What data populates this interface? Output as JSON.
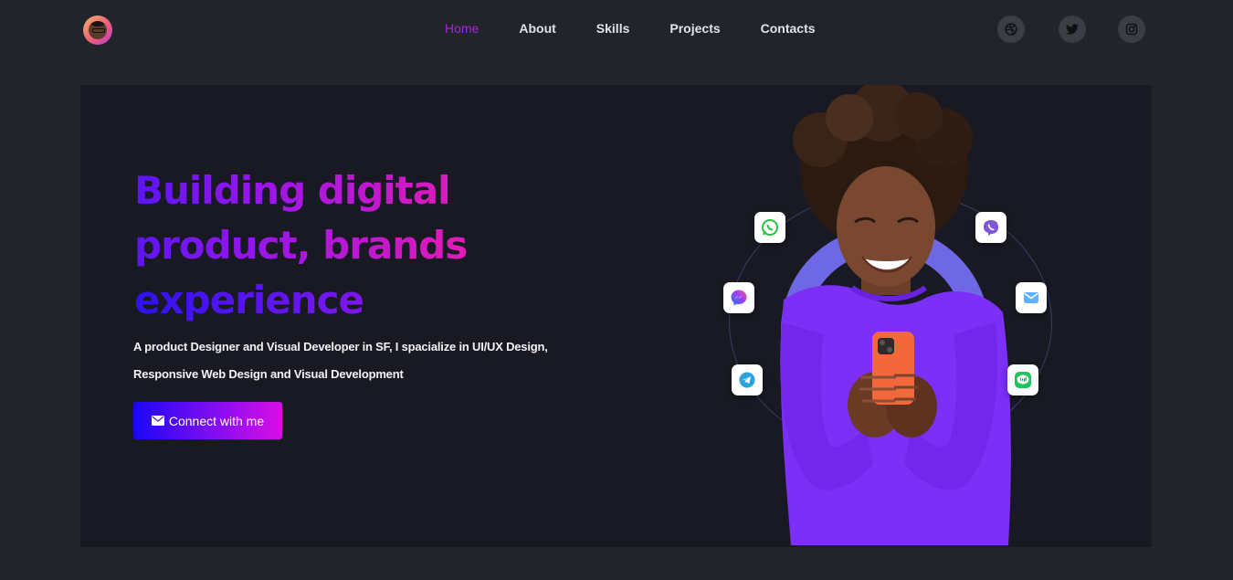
{
  "header": {
    "nav": [
      {
        "label": "Home",
        "active": true
      },
      {
        "label": "About",
        "active": false
      },
      {
        "label": "Skills",
        "active": false
      },
      {
        "label": "Projects",
        "active": false
      },
      {
        "label": "Contacts",
        "active": false
      }
    ],
    "social_icons": [
      "dribbble-icon",
      "twitter-icon",
      "instagram-icon"
    ]
  },
  "hero": {
    "headline": [
      "Building digital",
      "product, brands",
      "experience"
    ],
    "subtitle_line1": "A product Designer and Visual Developer in SF, I spacialize in UI/UX Design,",
    "subtitle_line2": "Responsive Web Design and Visual Development",
    "cta_label": "Connect with me",
    "app_icons": [
      "whatsapp-icon",
      "viber-icon",
      "messenger-icon",
      "mail-icon",
      "telegram-icon",
      "line-icon"
    ]
  },
  "colors": {
    "page_bg": "#22242c",
    "hero_bg": "#181922",
    "accent_active": "#b11ee3",
    "gradient_start": "#1a07f5",
    "gradient_end": "#d90ee6",
    "sweater": "#7b2ff7"
  }
}
